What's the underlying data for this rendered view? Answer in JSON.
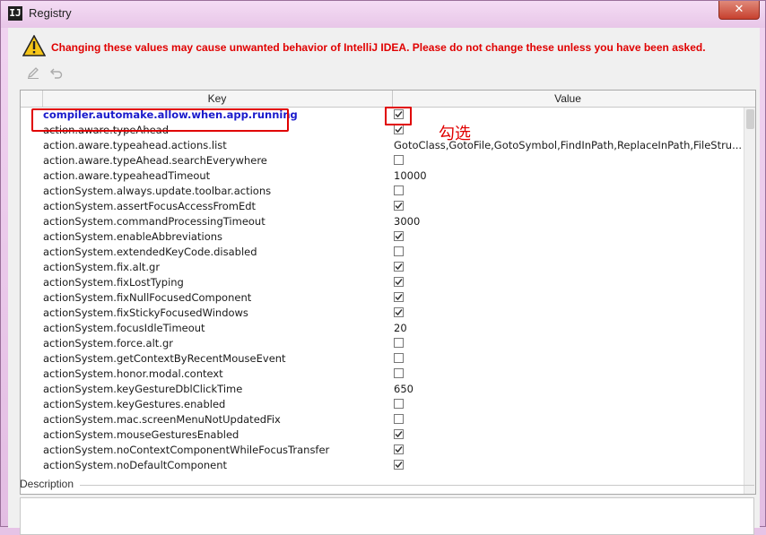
{
  "window": {
    "title": "Registry",
    "app_icon": "IJ"
  },
  "warning": {
    "icon": "warning-triangle-icon",
    "text": "Changing these values may cause unwanted behavior of IntelliJ IDEA. Please do not change these unless you have been asked."
  },
  "toolbar": {
    "edit_icon": "pencil-icon",
    "revert_icon": "undo-icon"
  },
  "table": {
    "headers": {
      "key": "Key",
      "value": "Value"
    },
    "rows": [
      {
        "key": "compiler.automake.allow.when.app.running",
        "type": "checkbox",
        "checked": true
      },
      {
        "key": "action.aware.typeAhead",
        "type": "checkbox",
        "checked": true
      },
      {
        "key": "action.aware.typeahead.actions.list",
        "type": "text",
        "value": "GotoClass,GotoFile,GotoSymbol,FindInPath,ReplaceInPath,FileStru..."
      },
      {
        "key": "action.aware.typeAhead.searchEverywhere",
        "type": "checkbox",
        "checked": false
      },
      {
        "key": "action.aware.typeaheadTimeout",
        "type": "text",
        "value": "10000"
      },
      {
        "key": "actionSystem.always.update.toolbar.actions",
        "type": "checkbox",
        "checked": false
      },
      {
        "key": "actionSystem.assertFocusAccessFromEdt",
        "type": "checkbox",
        "checked": true
      },
      {
        "key": "actionSystem.commandProcessingTimeout",
        "type": "text",
        "value": "3000"
      },
      {
        "key": "actionSystem.enableAbbreviations",
        "type": "checkbox",
        "checked": true
      },
      {
        "key": "actionSystem.extendedKeyCode.disabled",
        "type": "checkbox",
        "checked": false
      },
      {
        "key": "actionSystem.fix.alt.gr",
        "type": "checkbox",
        "checked": true
      },
      {
        "key": "actionSystem.fixLostTyping",
        "type": "checkbox",
        "checked": true
      },
      {
        "key": "actionSystem.fixNullFocusedComponent",
        "type": "checkbox",
        "checked": true
      },
      {
        "key": "actionSystem.fixStickyFocusedWindows",
        "type": "checkbox",
        "checked": true
      },
      {
        "key": "actionSystem.focusIdleTimeout",
        "type": "text",
        "value": "20"
      },
      {
        "key": "actionSystem.force.alt.gr",
        "type": "checkbox",
        "checked": false
      },
      {
        "key": "actionSystem.getContextByRecentMouseEvent",
        "type": "checkbox",
        "checked": false
      },
      {
        "key": "actionSystem.honor.modal.context",
        "type": "checkbox",
        "checked": false
      },
      {
        "key": "actionSystem.keyGestureDblClickTime",
        "type": "text",
        "value": "650"
      },
      {
        "key": "actionSystem.keyGestures.enabled",
        "type": "checkbox",
        "checked": false
      },
      {
        "key": "actionSystem.mac.screenMenuNotUpdatedFix",
        "type": "checkbox",
        "checked": false
      },
      {
        "key": "actionSystem.mouseGesturesEnabled",
        "type": "checkbox",
        "checked": true
      },
      {
        "key": "actionSystem.noContextComponentWhileFocusTransfer",
        "type": "checkbox",
        "checked": true
      },
      {
        "key": "actionSystem.noDefaultComponent",
        "type": "checkbox",
        "checked": true
      }
    ]
  },
  "annotation": {
    "text": "勾选"
  },
  "description": {
    "label": "Description"
  },
  "colors": {
    "warning": "#e00000",
    "highlighted_key": "#1a1acc"
  }
}
